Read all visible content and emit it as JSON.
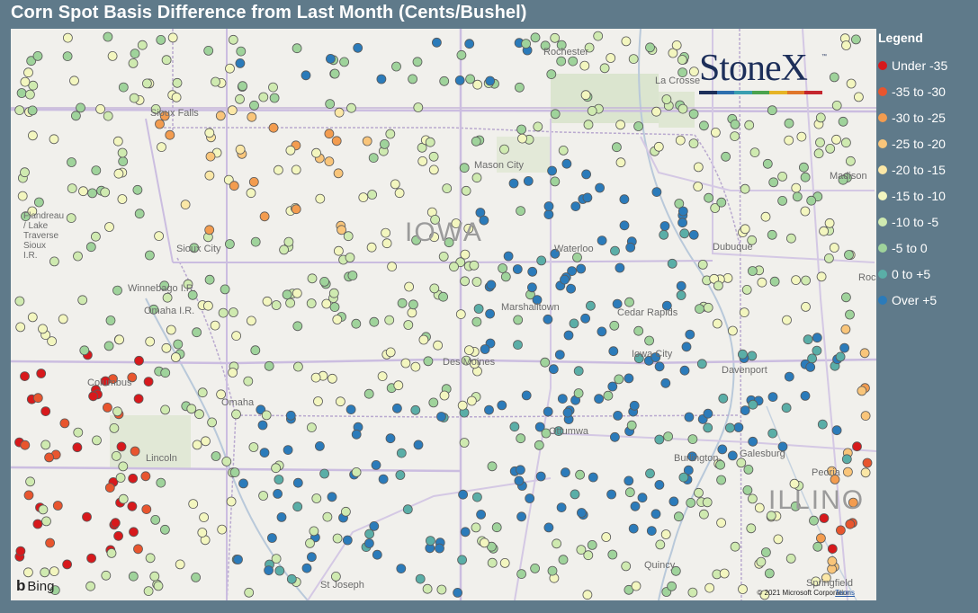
{
  "title": "Corn Spot Basis Difference from Last Month (Cents/Bushel)",
  "legend": {
    "title": "Legend",
    "items": [
      {
        "label": "Under -35",
        "color": "#d7191c"
      },
      {
        "label": "-35 to -30",
        "color": "#e8552e"
      },
      {
        "label": "-30 to -25",
        "color": "#f39c4f"
      },
      {
        "label": "-25 to -20",
        "color": "#f9c57a"
      },
      {
        "label": "-20 to -15",
        "color": "#fbe7a6"
      },
      {
        "label": "-15 to -10",
        "color": "#f3f6bf"
      },
      {
        "label": "-10 to -5",
        "color": "#cfeab0"
      },
      {
        "label": "-5 to 0",
        "color": "#9fd39b"
      },
      {
        "label": "0 to +5",
        "color": "#5aaea7"
      },
      {
        "label": "Over +5",
        "color": "#2b7bba"
      }
    ]
  },
  "logo": {
    "text": "StoneX",
    "tm": "™"
  },
  "map": {
    "state_labels": [
      "IOWA",
      "ILLINO"
    ],
    "city_labels": [
      "Rochester",
      "La Crosse",
      "Madison",
      "Sioux Falls",
      "Mason City",
      "Sioux City",
      "Waterloo",
      "Dubuque",
      "Winnebago I.R.",
      "Omaha I.R.",
      "Marshalltown",
      "Cedar Rapids",
      "Roc",
      "Columbus",
      "Des Moines",
      "Iowa City",
      "Davenport",
      "Omaha",
      "Ottumwa",
      "Galesburg",
      "Lincoln",
      "Burlington",
      "Peoria",
      "Quincy",
      "St Joseph",
      "Springfield",
      "Flandreau / Lake Traverse Sioux I.R."
    ],
    "attribution": "Bing",
    "copyright": "© 2021 Microsoft Corporation",
    "terms": "Terms"
  }
}
